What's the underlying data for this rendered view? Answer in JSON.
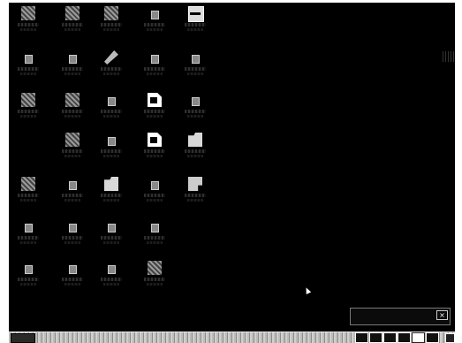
{
  "desktop": {
    "background_color": "#000000",
    "icons": [
      {
        "name": "icon-my-computer",
        "style": "g-gray"
      },
      {
        "name": "icon-network",
        "style": "g-gray"
      },
      {
        "name": "icon-settings",
        "style": "g-gray"
      },
      {
        "name": "icon-drive",
        "style": "g-small"
      },
      {
        "name": "icon-text-app",
        "style": "g-win"
      },
      {
        "name": "icon-folder-1",
        "style": "g-small"
      },
      {
        "name": "icon-folder-2",
        "style": "g-small"
      },
      {
        "name": "icon-edit-tool",
        "style": "g-pen"
      },
      {
        "name": "icon-folder-3",
        "style": "g-small"
      },
      {
        "name": "icon-folder-4",
        "style": "g-small"
      },
      {
        "name": "icon-image-tool",
        "style": "g-gray"
      },
      {
        "name": "icon-paint-tool",
        "style": "g-gray"
      },
      {
        "name": "icon-folder-5",
        "style": "g-small"
      },
      {
        "name": "icon-document-1",
        "style": "g-doc"
      },
      {
        "name": "icon-folder-6",
        "style": "g-small"
      },
      {
        "name": "icon-grid-app",
        "style": "g-gray"
      },
      {
        "name": "icon-folder-7",
        "style": "g-small"
      },
      {
        "name": "icon-document-2",
        "style": "g-doc"
      },
      {
        "name": "icon-picture-doc",
        "style": "g-folder"
      },
      {
        "name": "icon-tool-1",
        "style": "g-gray"
      },
      {
        "name": "icon-folder-8",
        "style": "g-small"
      },
      {
        "name": "icon-folder-open",
        "style": "g-folder"
      },
      {
        "name": "icon-folder-9",
        "style": "g-small"
      },
      {
        "name": "icon-printer",
        "style": "g-top"
      },
      {
        "name": "icon-folder-10",
        "style": "g-small"
      },
      {
        "name": "icon-folder-11",
        "style": "g-small"
      },
      {
        "name": "icon-folder-12",
        "style": "g-small"
      },
      {
        "name": "icon-folder-13",
        "style": "g-small"
      },
      {
        "name": "icon-folder-14",
        "style": "g-small"
      },
      {
        "name": "icon-folder-15",
        "style": "g-small"
      },
      {
        "name": "icon-folder-16",
        "style": "g-small"
      },
      {
        "name": "icon-recycle-bin",
        "style": "g-gray"
      }
    ]
  },
  "tray_window": {
    "close_label": "×"
  },
  "taskbar": {
    "start_label": "",
    "tray_buttons": [
      "tray-btn",
      "tray-btn",
      "tray-btn",
      "tray-btn",
      "tray-btn light",
      "tray-btn"
    ]
  }
}
